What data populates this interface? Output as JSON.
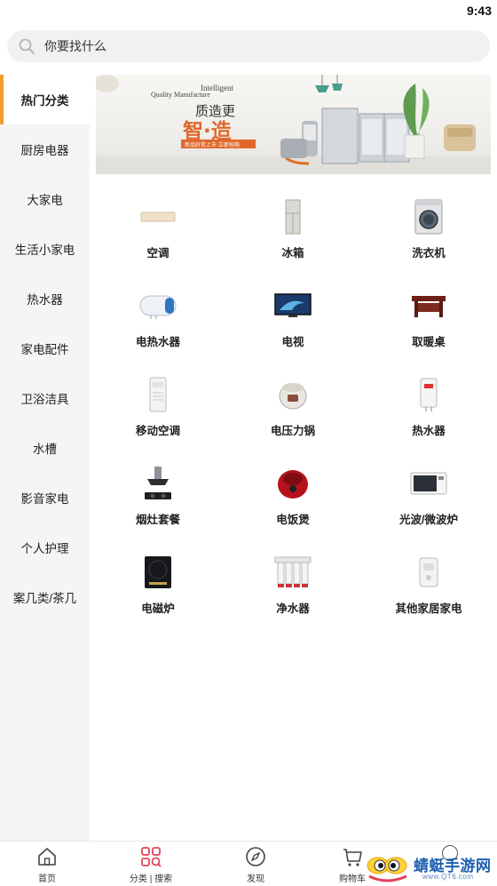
{
  "status": {
    "time": "9:43"
  },
  "search": {
    "placeholder": "你要找什么"
  },
  "sidebar": {
    "items": [
      {
        "label": "热门分类",
        "active": true
      },
      {
        "label": "厨房电器"
      },
      {
        "label": "大家电"
      },
      {
        "label": "生活小家电"
      },
      {
        "label": "热水器"
      },
      {
        "label": "家电配件"
      },
      {
        "label": "卫浴洁具"
      },
      {
        "label": "水槽"
      },
      {
        "label": "影音家电"
      },
      {
        "label": "个人护理"
      },
      {
        "label": "案几类/茶几"
      }
    ]
  },
  "banner": {
    "line1": "Intelligent",
    "line2": "Quality Manufacture",
    "headline": "质造更",
    "headline2": "智·造",
    "tagline": "新品好货上市 立即抢购"
  },
  "categories": [
    {
      "label": "空调",
      "icon": "air-conditioner-icon"
    },
    {
      "label": "冰箱",
      "icon": "refrigerator-icon"
    },
    {
      "label": "洗衣机",
      "icon": "washing-machine-icon"
    },
    {
      "label": "电热水器",
      "icon": "electric-water-heater-icon"
    },
    {
      "label": "电视",
      "icon": "tv-icon"
    },
    {
      "label": "取暖桌",
      "icon": "heating-table-icon"
    },
    {
      "label": "移动空调",
      "icon": "portable-ac-icon"
    },
    {
      "label": "电压力锅",
      "icon": "pressure-cooker-icon"
    },
    {
      "label": "热水器",
      "icon": "water-heater-icon"
    },
    {
      "label": "烟灶套餐",
      "icon": "range-hood-set-icon"
    },
    {
      "label": "电饭煲",
      "icon": "rice-cooker-icon"
    },
    {
      "label": "光波/微波炉",
      "icon": "microwave-icon"
    },
    {
      "label": "电磁炉",
      "icon": "induction-cooker-icon"
    },
    {
      "label": "净水器",
      "icon": "water-purifier-icon"
    },
    {
      "label": "其他家居家电",
      "icon": "other-appliance-icon"
    }
  ],
  "tabbar": {
    "items": [
      {
        "label": "首页",
        "icon": "home-icon"
      },
      {
        "label": "分类 | 搜索",
        "icon": "category-icon",
        "active": true
      },
      {
        "label": "发现",
        "icon": "compass-icon"
      },
      {
        "label": "购物车",
        "icon": "cart-icon"
      }
    ]
  },
  "watermark": {
    "title": "蜻蜓手游网",
    "url": "www.QT6.com"
  },
  "colors": {
    "accent": "#f39c2f",
    "active_tab": "#e0435a",
    "sidebar_bg": "#f5f5f5"
  }
}
